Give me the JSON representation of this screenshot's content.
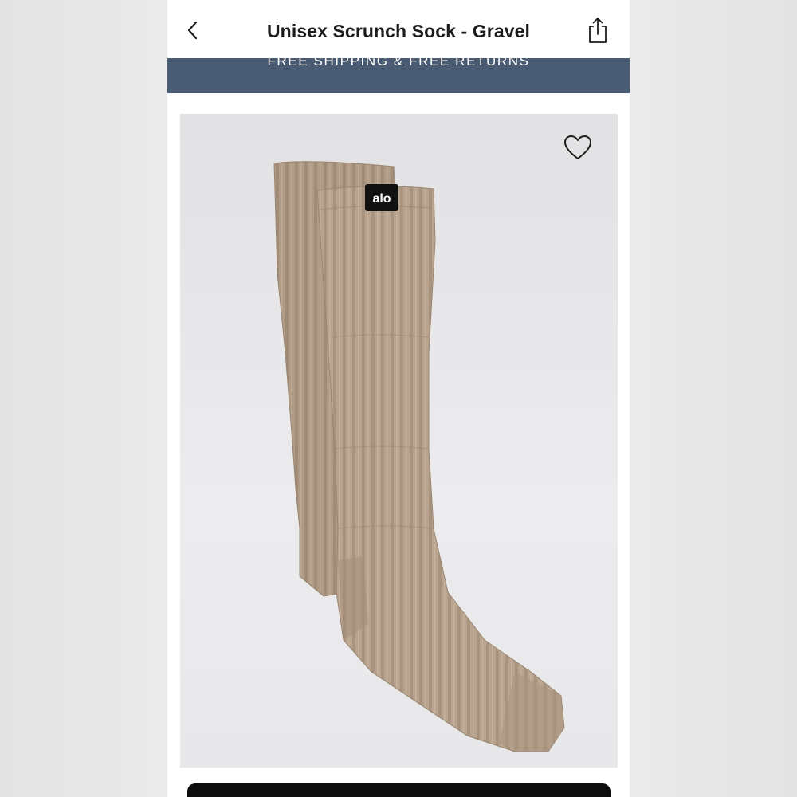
{
  "header": {
    "title": "Unisex Scrunch Sock - Gravel",
    "back_icon": "chevron-left-icon",
    "share_icon": "share-icon"
  },
  "banner": {
    "text": "FREE SHIPPING & FREE RETURNS",
    "background": "#4a5b74"
  },
  "product": {
    "image_alt": "Unisex Scrunch Sock - Gravel",
    "brand_tag": "alo",
    "favorite_icon": "heart-icon",
    "color": "#b09c86"
  },
  "cta": {
    "background": "#0d0d0d"
  }
}
